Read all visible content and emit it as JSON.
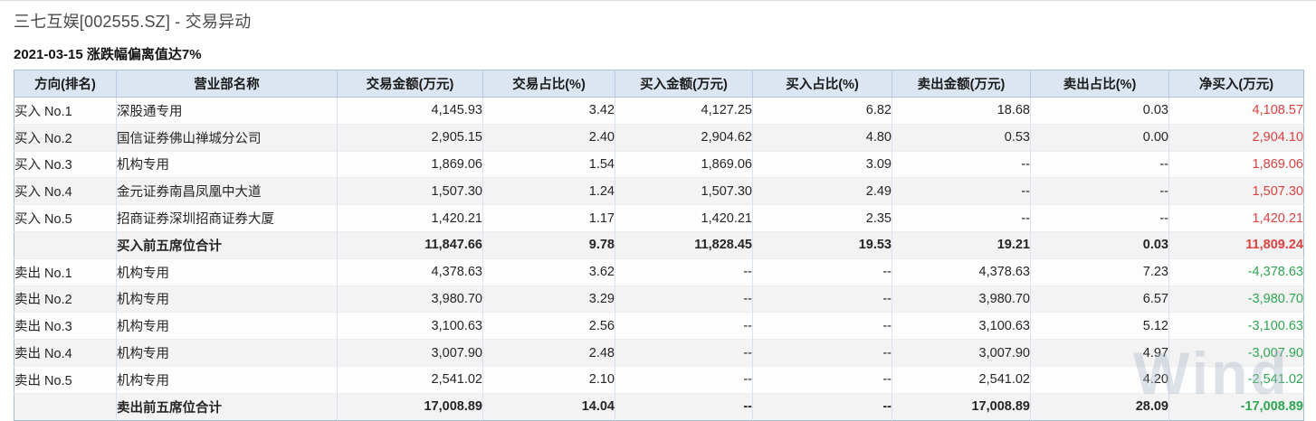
{
  "header": {
    "title": "三七互娱[002555.SZ] - 交易异动",
    "subtitle": "2021-03-15 涨跌幅偏离值达7%"
  },
  "table": {
    "columns": [
      "方向(排名)",
      "营业部名称",
      "交易金额(万元)",
      "交易占比(%)",
      "买入金额(万元)",
      "买入占比(%)",
      "卖出金额(万元)",
      "卖出占比(%)",
      "净买入(万元)"
    ],
    "rows": [
      {
        "direction": "买入 No.1",
        "branch": "深股通专用",
        "trade_amount": "4,145.93",
        "trade_pct": "3.42",
        "buy_amount": "4,127.25",
        "buy_pct": "6.82",
        "sell_amount": "18.68",
        "sell_pct": "0.03",
        "net_buy": "4,108.57",
        "subtotal": false
      },
      {
        "direction": "买入 No.2",
        "branch": "国信证券佛山禅城分公司",
        "trade_amount": "2,905.15",
        "trade_pct": "2.40",
        "buy_amount": "2,904.62",
        "buy_pct": "4.80",
        "sell_amount": "0.53",
        "sell_pct": "0.00",
        "net_buy": "2,904.10",
        "subtotal": false
      },
      {
        "direction": "买入 No.3",
        "branch": "机构专用",
        "trade_amount": "1,869.06",
        "trade_pct": "1.54",
        "buy_amount": "1,869.06",
        "buy_pct": "3.09",
        "sell_amount": "--",
        "sell_pct": "--",
        "net_buy": "1,869.06",
        "subtotal": false
      },
      {
        "direction": "买入 No.4",
        "branch": "金元证券南昌凤凰中大道",
        "trade_amount": "1,507.30",
        "trade_pct": "1.24",
        "buy_amount": "1,507.30",
        "buy_pct": "2.49",
        "sell_amount": "--",
        "sell_pct": "--",
        "net_buy": "1,507.30",
        "subtotal": false
      },
      {
        "direction": "买入 No.5",
        "branch": "招商证券深圳招商证券大厦",
        "trade_amount": "1,420.21",
        "trade_pct": "1.17",
        "buy_amount": "1,420.21",
        "buy_pct": "2.35",
        "sell_amount": "--",
        "sell_pct": "--",
        "net_buy": "1,420.21",
        "subtotal": false
      },
      {
        "direction": "",
        "branch": "买入前五席位合计",
        "trade_amount": "11,847.66",
        "trade_pct": "9.78",
        "buy_amount": "11,828.45",
        "buy_pct": "19.53",
        "sell_amount": "19.21",
        "sell_pct": "0.03",
        "net_buy": "11,809.24",
        "subtotal": true
      },
      {
        "direction": "卖出 No.1",
        "branch": "机构专用",
        "trade_amount": "4,378.63",
        "trade_pct": "3.62",
        "buy_amount": "--",
        "buy_pct": "--",
        "sell_amount": "4,378.63",
        "sell_pct": "7.23",
        "net_buy": "-4,378.63",
        "subtotal": false
      },
      {
        "direction": "卖出 No.2",
        "branch": "机构专用",
        "trade_amount": "3,980.70",
        "trade_pct": "3.29",
        "buy_amount": "--",
        "buy_pct": "--",
        "sell_amount": "3,980.70",
        "sell_pct": "6.57",
        "net_buy": "-3,980.70",
        "subtotal": false
      },
      {
        "direction": "卖出 No.3",
        "branch": "机构专用",
        "trade_amount": "3,100.63",
        "trade_pct": "2.56",
        "buy_amount": "--",
        "buy_pct": "--",
        "sell_amount": "3,100.63",
        "sell_pct": "5.12",
        "net_buy": "-3,100.63",
        "subtotal": false
      },
      {
        "direction": "卖出 No.4",
        "branch": "机构专用",
        "trade_amount": "3,007.90",
        "trade_pct": "2.48",
        "buy_amount": "--",
        "buy_pct": "--",
        "sell_amount": "3,007.90",
        "sell_pct": "4.97",
        "net_buy": "-3,007.90",
        "subtotal": false
      },
      {
        "direction": "卖出 No.5",
        "branch": "机构专用",
        "trade_amount": "2,541.02",
        "trade_pct": "2.10",
        "buy_amount": "--",
        "buy_pct": "--",
        "sell_amount": "2,541.02",
        "sell_pct": "4.20",
        "net_buy": "-2,541.02",
        "subtotal": false
      },
      {
        "direction": "",
        "branch": "卖出前五席位合计",
        "trade_amount": "17,008.89",
        "trade_pct": "14.04",
        "buy_amount": "--",
        "buy_pct": "--",
        "sell_amount": "17,008.89",
        "sell_pct": "28.09",
        "net_buy": "-17,008.89",
        "subtotal": true
      }
    ]
  },
  "watermark": {
    "text": "Wind"
  },
  "colors": {
    "positive_net_buy": "#df4040",
    "negative_net_buy": "#2ea651",
    "header_background": "#dce6f2",
    "table_border": "#a3bfdc",
    "alt_row_background": "#f3f3f3"
  }
}
